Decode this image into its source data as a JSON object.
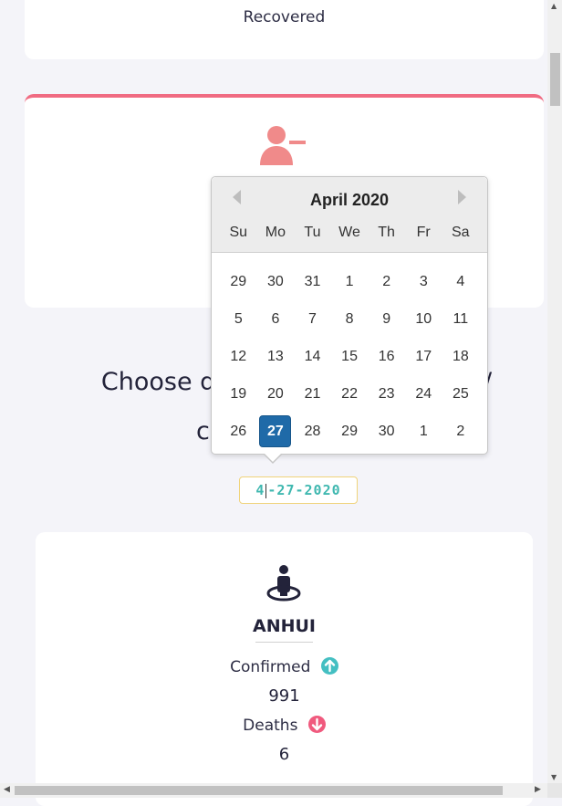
{
  "recovered_card": {
    "label": "Recovered"
  },
  "deaths_card": {
    "icon": "person-minus-icon"
  },
  "date_section": {
    "title_visible_left": "Choose date",
    "title_visible_right": "/",
    "title_line2_visible": "c",
    "date_value": "4-27-2020"
  },
  "datepicker": {
    "month_title": "April 2020",
    "weekdays": [
      "Su",
      "Mo",
      "Tu",
      "We",
      "Th",
      "Fr",
      "Sa"
    ],
    "days": [
      "29",
      "30",
      "31",
      "1",
      "2",
      "3",
      "4",
      "5",
      "6",
      "7",
      "8",
      "9",
      "10",
      "11",
      "12",
      "13",
      "14",
      "15",
      "16",
      "17",
      "18",
      "19",
      "20",
      "21",
      "22",
      "23",
      "24",
      "25",
      "26",
      "27",
      "28",
      "29",
      "30",
      "1",
      "2"
    ],
    "selected_day": "27",
    "selected_color": "#1f6aa8"
  },
  "province_card": {
    "icon": "map-pin-person-icon",
    "name": "ANHUI",
    "confirmed_label": "Confirmed",
    "confirmed_value": "991",
    "deaths_label": "Deaths",
    "deaths_value": "6",
    "up_badge_color": "#44bfc2",
    "down_badge_color": "#f05a7e"
  },
  "accent_color": "#f06b82"
}
